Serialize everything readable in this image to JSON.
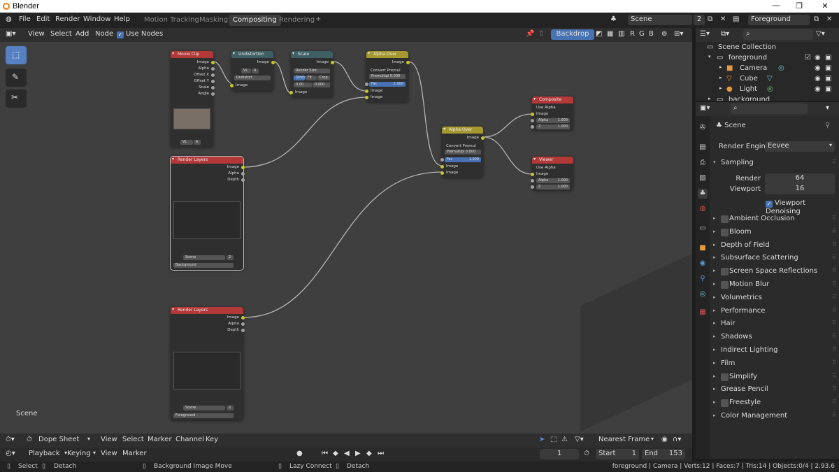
{
  "window": {
    "title": "Blender"
  },
  "menu": [
    "File",
    "Edit",
    "Render",
    "Window",
    "Help"
  ],
  "workspaces": [
    "Motion Tracking",
    "Masking",
    "Compositing",
    "Rendering"
  ],
  "active_workspace": "Compositing",
  "scene": {
    "name": "Scene",
    "users": "2"
  },
  "view_layer": "Foreground",
  "node_header": {
    "view": "View",
    "select": "Select",
    "add": "Add",
    "node": "Node",
    "use_nodes": "Use Nodes",
    "backdrop": "Backdrop",
    "rgb": [
      "R",
      "G",
      "B"
    ]
  },
  "nodes": {
    "movie_clip": {
      "title": "Movie Clip",
      "outputs": [
        "Image",
        "Alpha",
        "Offset X",
        "Offset Y",
        "Scale",
        "Angle"
      ],
      "clip": "VL",
      "clip_users": "6"
    },
    "undistortion": {
      "title": "Undistortion",
      "out": "Image",
      "clip": "VL",
      "clip_users": "4",
      "method": "Undistort",
      "in": "Image"
    },
    "scale": {
      "title": "Scale",
      "out": "Image",
      "space": "Render Size",
      "buttons": [
        "Stretch",
        "Fit",
        "Crop"
      ],
      "x": "0.00",
      "y": "0.000",
      "in": "Image"
    },
    "alpha_over_1": {
      "title": "Alpha Over",
      "out": "Image",
      "convert": "Convert Premul",
      "premul": "Premultipl 0.000",
      "fac_label": "Fac",
      "fac": "1.000",
      "in1": "Image",
      "in2": "Image"
    },
    "alpha_over_2": {
      "title": "Alpha Over",
      "out": "Image",
      "convert": "Convert Premul",
      "premul": "Premultipl 0.000",
      "fac_label": "Fac",
      "fac": "1.000",
      "in1": "Image",
      "in2": "Image"
    },
    "composite": {
      "title": "Composite",
      "use_alpha": "Use Alpha",
      "in": "Image",
      "alpha_label": "Alpha",
      "alpha": "1.000",
      "z_label": "Z",
      "z": "1.000"
    },
    "viewer": {
      "title": "Viewer",
      "use_alpha": "Use Alpha",
      "in": "Image",
      "alpha_label": "Alpha",
      "alpha": "1.000",
      "z_label": "Z",
      "z": "1.000"
    },
    "render_layers_1": {
      "title": "Render Layers",
      "outputs": [
        "Image",
        "Alpha",
        "Depth"
      ],
      "scene": "Scene",
      "users": "2",
      "layer": "Background"
    },
    "render_layers_2": {
      "title": "Render Layers",
      "outputs": [
        "Image",
        "Alpha",
        "Depth"
      ],
      "scene": "Scene",
      "users": "2",
      "layer": "Foreground"
    }
  },
  "editor_label": "Scene",
  "outliner": {
    "root": "Scene Collection",
    "rows": [
      {
        "name": "foreground",
        "indent": 1
      },
      {
        "name": "Camera",
        "indent": 2
      },
      {
        "name": "Cube",
        "indent": 2
      },
      {
        "name": "Light",
        "indent": 2
      },
      {
        "name": "background",
        "indent": 1
      }
    ]
  },
  "properties": {
    "context": "Scene",
    "render_engine_label": "Render Engine",
    "render_engine": "Eevee",
    "sampling": {
      "title": "Sampling",
      "render_label": "Render",
      "render": "64",
      "viewport_label": "Viewport",
      "viewport": "16",
      "denoise": "Viewport Denoising"
    },
    "sections": [
      {
        "label": "Ambient Occlusion",
        "checkbox": true
      },
      {
        "label": "Bloom",
        "checkbox": true
      },
      {
        "label": "Depth of Field",
        "checkbox": false
      },
      {
        "label": "Subsurface Scattering",
        "checkbox": false
      },
      {
        "label": "Screen Space Reflections",
        "checkbox": true
      },
      {
        "label": "Motion Blur",
        "checkbox": true
      },
      {
        "label": "Volumetrics",
        "checkbox": false
      },
      {
        "label": "Performance",
        "checkbox": false
      },
      {
        "label": "Hair",
        "checkbox": false
      },
      {
        "label": "Shadows",
        "checkbox": false
      },
      {
        "label": "Indirect Lighting",
        "checkbox": false
      },
      {
        "label": "Film",
        "checkbox": false
      },
      {
        "label": "Simplify",
        "checkbox": true
      },
      {
        "label": "Grease Pencil",
        "checkbox": false
      },
      {
        "label": "Freestyle",
        "checkbox": true
      },
      {
        "label": "Color Management",
        "checkbox": false
      }
    ]
  },
  "dopesheet": {
    "mode": "Dope Sheet",
    "menus": [
      "View",
      "Select",
      "Marker",
      "Channel",
      "Key"
    ],
    "snap": "Nearest Frame"
  },
  "timeline": {
    "menus": [
      "Playback",
      "Keying",
      "View",
      "Marker"
    ],
    "frame": "1",
    "start_label": "Start",
    "start": "1",
    "end_label": "End",
    "end": "153"
  },
  "status": {
    "select": "Select",
    "detach1": "Detach",
    "bg_move": "Background Image Move",
    "lazy": "Lazy Connect",
    "detach2": "Detach",
    "info": "foreground | Camera | Verts:12 | Faces:7 | Tris:14 | Objects:0/4 | 2.93.6"
  },
  "colors": {
    "accent": "#4772b3",
    "socket_image": "#c7c729",
    "header_movieclip": "#a33",
    "header_converter": "#4a6a6a",
    "header_color": "#a59830",
    "header_output": "#a33"
  }
}
